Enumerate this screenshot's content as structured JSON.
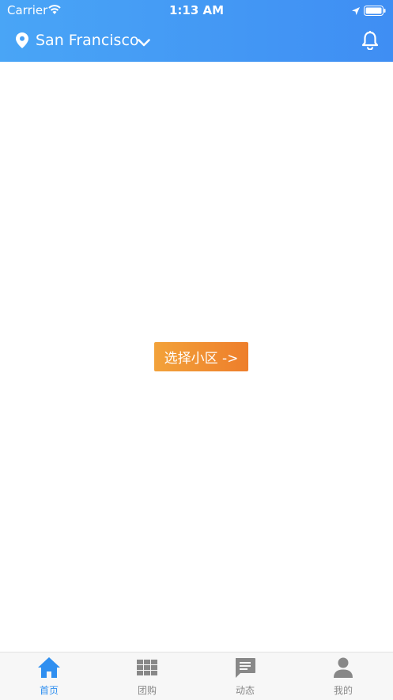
{
  "status_bar": {
    "carrier": "Carrier",
    "time": "1:13 AM"
  },
  "header": {
    "city": "San Francisco",
    "icons": [
      "location-pin-icon",
      "chevron-down-icon",
      "bell-icon"
    ]
  },
  "main": {
    "select_button_label": "选择小区 ->"
  },
  "tabs": [
    {
      "label": "首页",
      "icon": "home-icon",
      "active": true
    },
    {
      "label": "团购",
      "icon": "grid-icon",
      "active": false
    },
    {
      "label": "动态",
      "icon": "message-icon",
      "active": false
    },
    {
      "label": "我的",
      "icon": "person-icon",
      "active": false
    }
  ],
  "colors": {
    "header_gradient": [
      "#49a5f6",
      "#3f8ef3"
    ],
    "button_gradient": [
      "#f2a23a",
      "#ee7e2b"
    ],
    "tab_active": "#2f8ff0",
    "tab_inactive": "#888888"
  }
}
